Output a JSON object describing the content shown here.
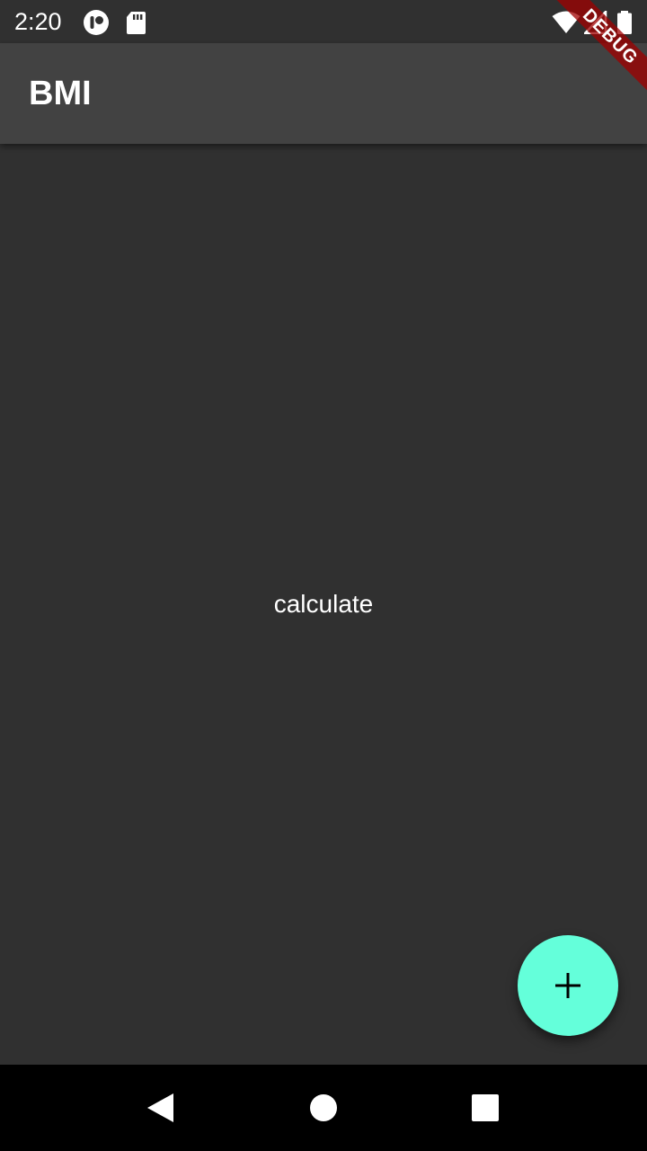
{
  "status_bar": {
    "time": "2:20",
    "left_icons": [
      "notification-app-icon",
      "sd-card-icon"
    ],
    "right_icons": [
      "wifi-icon",
      "cellular-signal-icon",
      "battery-icon"
    ]
  },
  "app_bar": {
    "title": "BMI"
  },
  "body": {
    "center_text": "calculate"
  },
  "fab": {
    "icon": "add-icon",
    "color": "#64ffda"
  },
  "nav_bar": {
    "buttons": [
      "back-icon",
      "home-icon",
      "recents-icon"
    ]
  },
  "debug_banner": {
    "label": "DEBUG"
  },
  "colors": {
    "background": "#303030",
    "app_bar": "#424242",
    "accent": "#64ffda",
    "nav_bar": "#000000"
  }
}
